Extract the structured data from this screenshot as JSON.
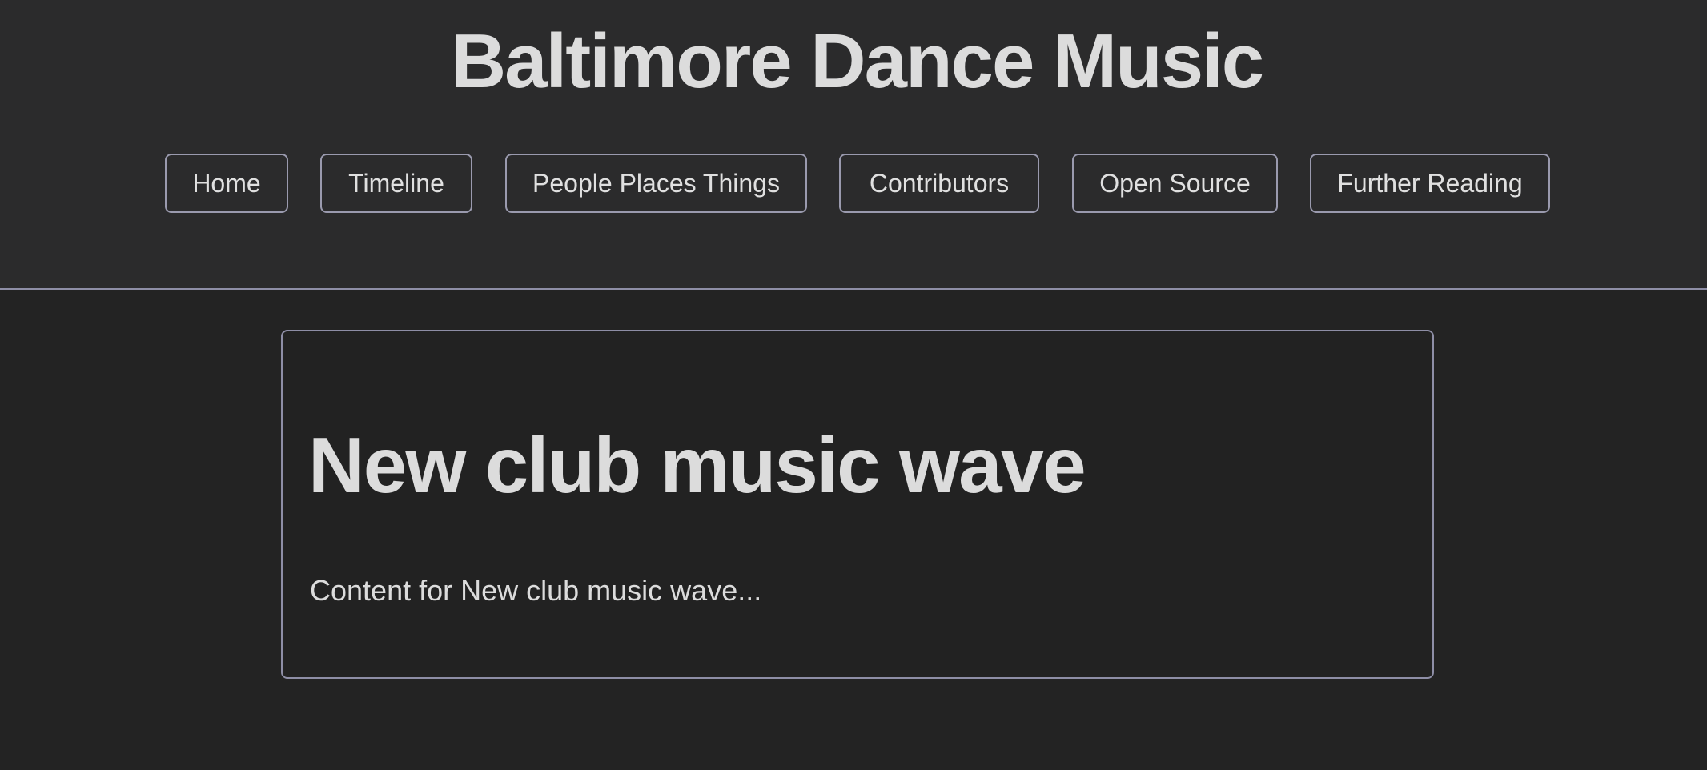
{
  "header": {
    "title": "Baltimore Dance Music"
  },
  "nav": {
    "items": [
      {
        "label": "Home"
      },
      {
        "label": "Timeline"
      },
      {
        "label": "People Places Things"
      },
      {
        "label": "Contributors"
      },
      {
        "label": "Open Source"
      },
      {
        "label": "Further Reading"
      }
    ]
  },
  "article": {
    "heading": "New club music wave",
    "body": "Content for New club music wave..."
  },
  "colors": {
    "header_background": "#2b2b2c",
    "page_background": "#232323",
    "border": "#8e8ea6",
    "text": "#dcdcdc"
  }
}
